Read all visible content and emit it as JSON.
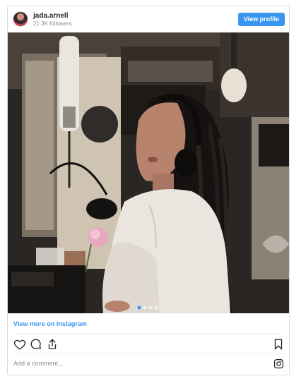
{
  "header": {
    "username": "jada.arnell",
    "followers": "21.3K followers",
    "view_profile_label": "View profile"
  },
  "post": {
    "image_alt": "Instagram post photo",
    "view_more_label": "View more on Instagram"
  },
  "actions": {
    "icons": [
      "heart-icon",
      "comment-icon",
      "share-icon",
      "bookmark-icon"
    ]
  },
  "comment": {
    "placeholder": "Add a comment..."
  },
  "colors": {
    "accent": "#3897f0",
    "border": "#dbdbdb",
    "muted_text": "#8e8e8e"
  }
}
